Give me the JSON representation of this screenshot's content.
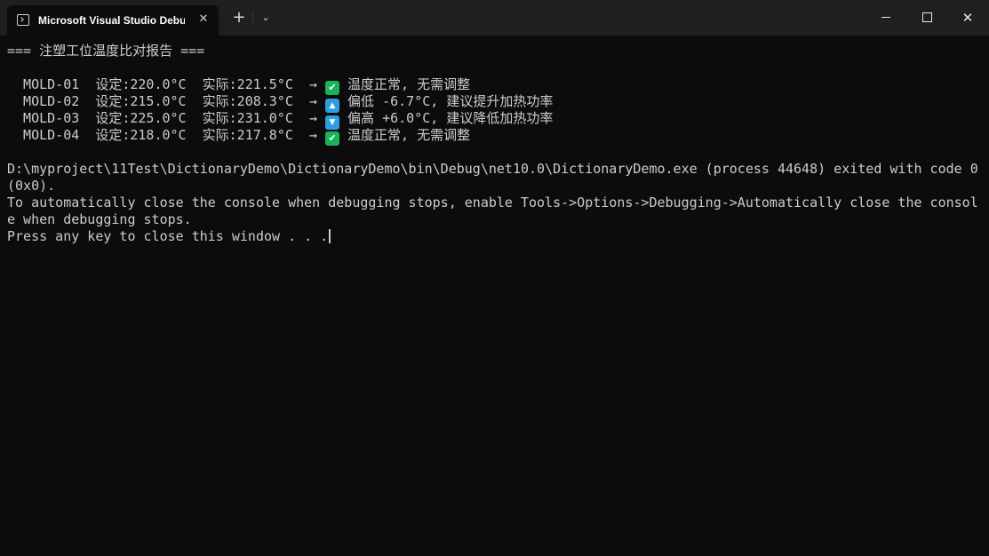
{
  "window": {
    "tab_title": "Microsoft Visual Studio Debug Console",
    "tab_close_glyph": "✕",
    "new_tab_glyph": "+",
    "dropdown_glyph": "⌄",
    "close_glyph": "✕"
  },
  "console": {
    "header": "=== 注塑工位温度比对报告 ===",
    "rows": [
      {
        "text": "  MOLD-01  设定:220.0°C  实际:221.5°C  → ",
        "status_icon": "check-mark-icon",
        "status_glyph": "✔",
        "message": " 温度正常, 无需调整"
      },
      {
        "text": "  MOLD-02  设定:215.0°C  实际:208.3°C  → ",
        "status_icon": "up-arrow-icon",
        "status_glyph": "▲",
        "message": " 偏低 -6.7°C, 建议提升加热功率"
      },
      {
        "text": "  MOLD-03  设定:225.0°C  实际:231.0°C  → ",
        "status_icon": "down-arrow-icon",
        "status_glyph": "▼",
        "message": " 偏高 +6.0°C, 建议降低加热功率"
      },
      {
        "text": "  MOLD-04  设定:218.0°C  实际:217.8°C  → ",
        "status_icon": "check-mark-icon",
        "status_glyph": "✔",
        "message": " 温度正常, 无需调整"
      }
    ],
    "exit_message": "D:\\myproject\\11Test\\DictionaryDemo\\DictionaryDemo\\bin\\Debug\\net10.0\\DictionaryDemo.exe (process 44648) exited with code 0 (0x0).",
    "auto_close_hint": "To automatically close the console when debugging stops, enable Tools->Options->Debugging->Automatically close the console when debugging stops.",
    "press_key": "Press any key to close this window . . ."
  },
  "colors": {
    "background": "#0c0c0c",
    "titlebar": "#1f1f1f",
    "text": "#cccccc",
    "ok_badge": "#17b45a",
    "arrow_badge": "#2d9ee0"
  }
}
